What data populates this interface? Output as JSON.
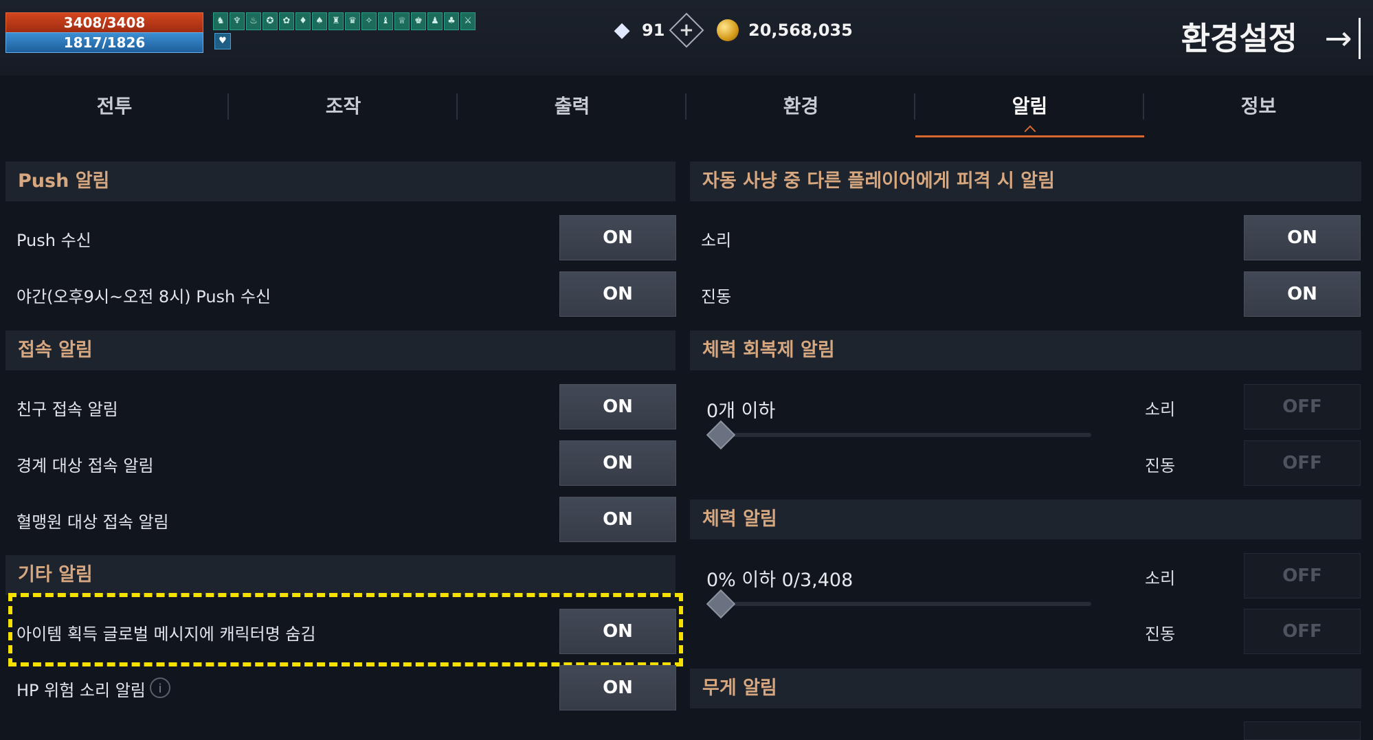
{
  "status": {
    "hp": "3408/3408",
    "mp": "1817/1826",
    "buff_icons": [
      "♞",
      "♆",
      "♨",
      "✪",
      "✿",
      "♦",
      "♠",
      "♜",
      "♛",
      "✧",
      "♝",
      "♕",
      "♚",
      "♟",
      "♣",
      "⚔"
    ],
    "buff_icon_secondary": "♥"
  },
  "currency": {
    "gems": "91",
    "gem_icon": "diamond-icon",
    "plus_icon": "plus-icon",
    "gold": "20,568,035",
    "gold_icon": "gold-coin-icon"
  },
  "header": {
    "title": "환경설정",
    "exit_icon": "exit-icon"
  },
  "tabs": [
    {
      "label": "전투",
      "active": false
    },
    {
      "label": "조작",
      "active": false
    },
    {
      "label": "출력",
      "active": false
    },
    {
      "label": "환경",
      "active": false
    },
    {
      "label": "알림",
      "active": true
    },
    {
      "label": "정보",
      "active": false
    }
  ],
  "left": {
    "push": {
      "title": "Push 알림",
      "items": [
        {
          "label": "Push 수신",
          "value": "ON"
        },
        {
          "label": "야간(오후9시~오전 8시) Push 수신",
          "value": "ON"
        }
      ]
    },
    "login": {
      "title": "접속 알림",
      "items": [
        {
          "label": "친구 접속 알림",
          "value": "ON"
        },
        {
          "label": "경계 대상 접속 알림",
          "value": "ON"
        },
        {
          "label": "혈맹원 대상 접속 알림",
          "value": "ON"
        }
      ]
    },
    "other": {
      "title": "기타 알림",
      "items": [
        {
          "label": "아이템 획득 글로벌 메시지에 캐릭터명 숨김",
          "value": "ON"
        },
        {
          "label": "HP 위험 소리 알림",
          "value": "ON",
          "info_icon": "i"
        }
      ]
    }
  },
  "right": {
    "attacked": {
      "title": "자동 사냥 중 다른 플레이어에게 피격 시 알림",
      "items": [
        {
          "label": "소리",
          "value": "ON"
        },
        {
          "label": "진동",
          "value": "ON"
        }
      ]
    },
    "potion": {
      "title": "체력 회복제 알림",
      "slider_value": "0개 이하",
      "slider_level": 0,
      "sound_label": "소리",
      "sound_value": "OFF",
      "vibe_label": "진동",
      "vibe_value": "OFF"
    },
    "health": {
      "title": "체력 알림",
      "slider_value": "0% 이하 0/3,408",
      "slider_level": 0,
      "sound_label": "소리",
      "sound_value": "OFF",
      "vibe_label": "진동",
      "vibe_value": "OFF"
    },
    "weight": {
      "title": "무게 알림"
    }
  },
  "colors": {
    "accent": "#d9682f",
    "section_title": "#d7a780",
    "highlight": "#f5e000"
  }
}
